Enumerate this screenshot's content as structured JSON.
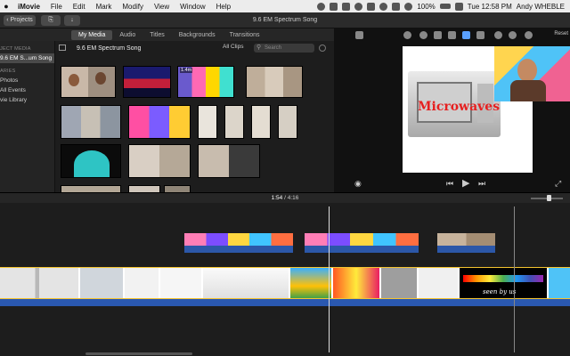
{
  "menubar": {
    "app": "iMovie",
    "menus": [
      "File",
      "Edit",
      "Mark",
      "Modify",
      "View",
      "Window",
      "Help"
    ],
    "battery": "100%",
    "clock": "Tue 12:58 PM",
    "user": "Andy WHEBLE"
  },
  "toolbar": {
    "projects_label": "Projects",
    "project_title": "9.6 EM Spectrum Song"
  },
  "tabs": [
    "My Media",
    "Audio",
    "Titles",
    "Backgrounds",
    "Transitions"
  ],
  "sidebar": {
    "header": "JECT MEDIA",
    "project_item": "9.6 EM S...um Song",
    "libraries_header": "ARIES",
    "items": [
      "Photos",
      "All Events",
      "vie Library"
    ]
  },
  "browser": {
    "title": "9.6 EM Spectrum Song",
    "filter": "All Clips",
    "search_placeholder": "Search",
    "first_clip_duration": "1.4m"
  },
  "viewer": {
    "reset_label": "Reset",
    "frame_title": "Microwaves"
  },
  "timeline": {
    "current_time": "1:54",
    "separator": "/",
    "total_time": "4:16",
    "overlay_caption": "seen by us"
  },
  "colors": {
    "accent_blue": "#2c57a8",
    "clip_border": "#f4c430",
    "title_red": "#e62020"
  }
}
